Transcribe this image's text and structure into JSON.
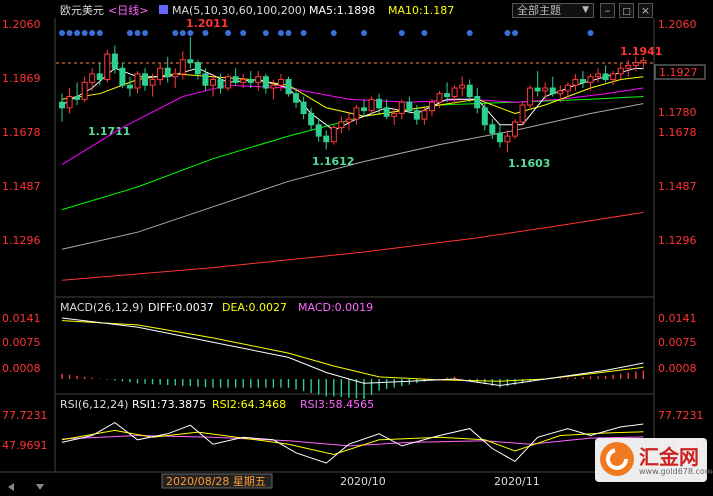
{
  "header": {
    "instrument": "欧元美元",
    "period": "<日线>",
    "ma_label": "MA(5,10,30,60,100,200)",
    "ma5_label": "MA5:1.1898",
    "ma10_label": "MA10:1.187",
    "theme_label": "全部主题",
    "colors": {
      "ma5": "#ffffff",
      "ma10": "#ffff00",
      "ma30": "#ff00ff",
      "ma60": "#00ff00",
      "ma100": "#aaaaaa",
      "ma200": "#ff3333"
    }
  },
  "price_axis": {
    "left": [
      "1.2060",
      "1.1869",
      "1.1678",
      "1.1487",
      "1.1296"
    ],
    "right": [
      "1.2060",
      "1.1927",
      "1.1780",
      "1.1678",
      "1.1487",
      "1.1296"
    ],
    "current": "1.1927"
  },
  "annotations": {
    "high": "1.2011",
    "recent_high": "1.1941",
    "low1": "1.1711",
    "low2": "1.1612",
    "low3": "1.1603"
  },
  "macd": {
    "title": "MACD(26,12,9)",
    "diff_label": "DIFF:0.0037",
    "dea_label": "DEA:0.0027",
    "macd_label": "MACD:0.0019",
    "axis": [
      "0.0141",
      "0.0075",
      "0.0008"
    ]
  },
  "rsi": {
    "title": "RSI(6,12,24)",
    "rsi1_label": "RSI1:73.3875",
    "rsi2_label": "RSI2:64.3468",
    "rsi3_label": "RSI3:58.4565",
    "axis": [
      "77.7231",
      "47.9691"
    ]
  },
  "x_axis": {
    "cursor_label": "2020/08/28 星期五",
    "ticks": [
      "2020/10",
      "2020/11"
    ]
  },
  "logo": {
    "name": "汇金网",
    "site": "www.gold678.com"
  },
  "chart_data": {
    "type": "candlestick",
    "title": "欧元美元 <日线>",
    "ylim": [
      1.12,
      1.206
    ],
    "candles": [
      {
        "o": 1.178,
        "h": 1.181,
        "l": 1.1711,
        "c": 1.176
      },
      {
        "o": 1.176,
        "h": 1.183,
        "l": 1.174,
        "c": 1.18
      },
      {
        "o": 1.18,
        "h": 1.185,
        "l": 1.177,
        "c": 1.179
      },
      {
        "o": 1.179,
        "h": 1.187,
        "l": 1.178,
        "c": 1.185
      },
      {
        "o": 1.185,
        "h": 1.19,
        "l": 1.182,
        "c": 1.188
      },
      {
        "o": 1.188,
        "h": 1.192,
        "l": 1.184,
        "c": 1.186
      },
      {
        "o": 1.186,
        "h": 1.1965,
        "l": 1.185,
        "c": 1.195
      },
      {
        "o": 1.195,
        "h": 1.198,
        "l": 1.188,
        "c": 1.19
      },
      {
        "o": 1.19,
        "h": 1.192,
        "l": 1.183,
        "c": 1.184
      },
      {
        "o": 1.184,
        "h": 1.187,
        "l": 1.18,
        "c": 1.183
      },
      {
        "o": 1.183,
        "h": 1.189,
        "l": 1.181,
        "c": 1.188
      },
      {
        "o": 1.188,
        "h": 1.19,
        "l": 1.182,
        "c": 1.184
      },
      {
        "o": 1.184,
        "h": 1.188,
        "l": 1.18,
        "c": 1.186
      },
      {
        "o": 1.186,
        "h": 1.192,
        "l": 1.184,
        "c": 1.19
      },
      {
        "o": 1.19,
        "h": 1.194,
        "l": 1.185,
        "c": 1.187
      },
      {
        "o": 1.187,
        "h": 1.19,
        "l": 1.183,
        "c": 1.188
      },
      {
        "o": 1.188,
        "h": 1.196,
        "l": 1.186,
        "c": 1.193
      },
      {
        "o": 1.193,
        "h": 1.2011,
        "l": 1.19,
        "c": 1.192
      },
      {
        "o": 1.192,
        "h": 1.193,
        "l": 1.186,
        "c": 1.188
      },
      {
        "o": 1.188,
        "h": 1.19,
        "l": 1.182,
        "c": 1.184
      },
      {
        "o": 1.184,
        "h": 1.188,
        "l": 1.18,
        "c": 1.186
      },
      {
        "o": 1.186,
        "h": 1.188,
        "l": 1.181,
        "c": 1.183
      },
      {
        "o": 1.183,
        "h": 1.188,
        "l": 1.182,
        "c": 1.187
      },
      {
        "o": 1.187,
        "h": 1.19,
        "l": 1.184,
        "c": 1.185
      },
      {
        "o": 1.185,
        "h": 1.188,
        "l": 1.183,
        "c": 1.186
      },
      {
        "o": 1.186,
        "h": 1.189,
        "l": 1.183,
        "c": 1.185
      },
      {
        "o": 1.185,
        "h": 1.189,
        "l": 1.182,
        "c": 1.187
      },
      {
        "o": 1.187,
        "h": 1.188,
        "l": 1.181,
        "c": 1.183
      },
      {
        "o": 1.183,
        "h": 1.186,
        "l": 1.179,
        "c": 1.184
      },
      {
        "o": 1.184,
        "h": 1.188,
        "l": 1.182,
        "c": 1.186
      },
      {
        "o": 1.186,
        "h": 1.187,
        "l": 1.18,
        "c": 1.181
      },
      {
        "o": 1.181,
        "h": 1.183,
        "l": 1.176,
        "c": 1.178
      },
      {
        "o": 1.178,
        "h": 1.18,
        "l": 1.172,
        "c": 1.174
      },
      {
        "o": 1.174,
        "h": 1.176,
        "l": 1.168,
        "c": 1.17
      },
      {
        "o": 1.17,
        "h": 1.172,
        "l": 1.164,
        "c": 1.166
      },
      {
        "o": 1.166,
        "h": 1.168,
        "l": 1.1612,
        "c": 1.164
      },
      {
        "o": 1.164,
        "h": 1.17,
        "l": 1.163,
        "c": 1.169
      },
      {
        "o": 1.169,
        "h": 1.173,
        "l": 1.167,
        "c": 1.171
      },
      {
        "o": 1.171,
        "h": 1.174,
        "l": 1.168,
        "c": 1.172
      },
      {
        "o": 1.172,
        "h": 1.177,
        "l": 1.17,
        "c": 1.176
      },
      {
        "o": 1.176,
        "h": 1.179,
        "l": 1.173,
        "c": 1.175
      },
      {
        "o": 1.175,
        "h": 1.18,
        "l": 1.174,
        "c": 1.179
      },
      {
        "o": 1.179,
        "h": 1.181,
        "l": 1.174,
        "c": 1.176
      },
      {
        "o": 1.176,
        "h": 1.179,
        "l": 1.172,
        "c": 1.173
      },
      {
        "o": 1.173,
        "h": 1.176,
        "l": 1.17,
        "c": 1.174
      },
      {
        "o": 1.174,
        "h": 1.179,
        "l": 1.172,
        "c": 1.178
      },
      {
        "o": 1.178,
        "h": 1.18,
        "l": 1.174,
        "c": 1.175
      },
      {
        "o": 1.175,
        "h": 1.177,
        "l": 1.17,
        "c": 1.172
      },
      {
        "o": 1.172,
        "h": 1.176,
        "l": 1.17,
        "c": 1.175
      },
      {
        "o": 1.175,
        "h": 1.179,
        "l": 1.173,
        "c": 1.178
      },
      {
        "o": 1.178,
        "h": 1.182,
        "l": 1.176,
        "c": 1.181
      },
      {
        "o": 1.181,
        "h": 1.185,
        "l": 1.178,
        "c": 1.18
      },
      {
        "o": 1.18,
        "h": 1.184,
        "l": 1.177,
        "c": 1.183
      },
      {
        "o": 1.183,
        "h": 1.187,
        "l": 1.18,
        "c": 1.184
      },
      {
        "o": 1.184,
        "h": 1.186,
        "l": 1.178,
        "c": 1.18
      },
      {
        "o": 1.18,
        "h": 1.183,
        "l": 1.174,
        "c": 1.176
      },
      {
        "o": 1.176,
        "h": 1.178,
        "l": 1.168,
        "c": 1.17
      },
      {
        "o": 1.17,
        "h": 1.172,
        "l": 1.165,
        "c": 1.167
      },
      {
        "o": 1.167,
        "h": 1.17,
        "l": 1.162,
        "c": 1.164
      },
      {
        "o": 1.164,
        "h": 1.168,
        "l": 1.1603,
        "c": 1.166
      },
      {
        "o": 1.166,
        "h": 1.172,
        "l": 1.165,
        "c": 1.171
      },
      {
        "o": 1.171,
        "h": 1.178,
        "l": 1.17,
        "c": 1.177
      },
      {
        "o": 1.177,
        "h": 1.184,
        "l": 1.176,
        "c": 1.183
      },
      {
        "o": 1.183,
        "h": 1.189,
        "l": 1.18,
        "c": 1.182
      },
      {
        "o": 1.182,
        "h": 1.185,
        "l": 1.179,
        "c": 1.183
      },
      {
        "o": 1.183,
        "h": 1.187,
        "l": 1.18,
        "c": 1.181
      },
      {
        "o": 1.181,
        "h": 1.184,
        "l": 1.178,
        "c": 1.182
      },
      {
        "o": 1.182,
        "h": 1.185,
        "l": 1.18,
        "c": 1.184
      },
      {
        "o": 1.184,
        "h": 1.188,
        "l": 1.182,
        "c": 1.186
      },
      {
        "o": 1.186,
        "h": 1.189,
        "l": 1.183,
        "c": 1.185
      },
      {
        "o": 1.185,
        "h": 1.188,
        "l": 1.182,
        "c": 1.187
      },
      {
        "o": 1.187,
        "h": 1.19,
        "l": 1.185,
        "c": 1.188
      },
      {
        "o": 1.188,
        "h": 1.191,
        "l": 1.185,
        "c": 1.186
      },
      {
        "o": 1.186,
        "h": 1.189,
        "l": 1.184,
        "c": 1.188
      },
      {
        "o": 1.188,
        "h": 1.192,
        "l": 1.186,
        "c": 1.19
      },
      {
        "o": 1.19,
        "h": 1.193,
        "l": 1.187,
        "c": 1.191
      },
      {
        "o": 1.191,
        "h": 1.1941,
        "l": 1.189,
        "c": 1.192
      },
      {
        "o": 1.192,
        "h": 1.194,
        "l": 1.19,
        "c": 1.1927
      }
    ],
    "ma": {
      "ma5": [
        [
          0,
          1.177
        ],
        [
          4,
          1.183
        ],
        [
          7,
          1.19
        ],
        [
          10,
          1.187
        ],
        [
          14,
          1.187
        ],
        [
          18,
          1.19
        ],
        [
          22,
          1.185
        ],
        [
          26,
          1.186
        ],
        [
          30,
          1.183
        ],
        [
          33,
          1.174
        ],
        [
          36,
          1.168
        ],
        [
          39,
          1.172
        ],
        [
          43,
          1.176
        ],
        [
          47,
          1.174
        ],
        [
          51,
          1.179
        ],
        [
          55,
          1.179
        ],
        [
          58,
          1.17
        ],
        [
          61,
          1.17
        ],
        [
          64,
          1.18
        ],
        [
          68,
          1.184
        ],
        [
          72,
          1.187
        ],
        [
          76,
          1.19
        ],
        [
          77,
          1.1898
        ]
      ],
      "ma10": [
        [
          0,
          1.179
        ],
        [
          5,
          1.181
        ],
        [
          10,
          1.186
        ],
        [
          15,
          1.188
        ],
        [
          20,
          1.187
        ],
        [
          25,
          1.186
        ],
        [
          30,
          1.184
        ],
        [
          35,
          1.176
        ],
        [
          40,
          1.173
        ],
        [
          45,
          1.175
        ],
        [
          50,
          1.177
        ],
        [
          55,
          1.179
        ],
        [
          60,
          1.174
        ],
        [
          64,
          1.177
        ],
        [
          70,
          1.183
        ],
        [
          74,
          1.186
        ],
        [
          77,
          1.187
        ]
      ],
      "ma30": [
        [
          0,
          1.156
        ],
        [
          8,
          1.169
        ],
        [
          16,
          1.18
        ],
        [
          22,
          1.184
        ],
        [
          30,
          1.183
        ],
        [
          38,
          1.179
        ],
        [
          46,
          1.178
        ],
        [
          54,
          1.179
        ],
        [
          60,
          1.178
        ],
        [
          66,
          1.179
        ],
        [
          72,
          1.181
        ],
        [
          77,
          1.183
        ]
      ],
      "ma60": [
        [
          0,
          1.14
        ],
        [
          10,
          1.148
        ],
        [
          20,
          1.158
        ],
        [
          30,
          1.166
        ],
        [
          40,
          1.173
        ],
        [
          50,
          1.177
        ],
        [
          60,
          1.178
        ],
        [
          70,
          1.179
        ],
        [
          77,
          1.18
        ]
      ],
      "ma100": [
        [
          0,
          1.126
        ],
        [
          10,
          1.132
        ],
        [
          20,
          1.141
        ],
        [
          30,
          1.15
        ],
        [
          40,
          1.157
        ],
        [
          50,
          1.163
        ],
        [
          60,
          1.168
        ],
        [
          70,
          1.174
        ],
        [
          77,
          1.1775
        ]
      ],
      "ma200": [
        [
          0,
          1.115
        ],
        [
          20,
          1.1195
        ],
        [
          40,
          1.125
        ],
        [
          55,
          1.13
        ],
        [
          65,
          1.134
        ],
        [
          77,
          1.139
        ]
      ]
    },
    "macd_series": {
      "diff": [
        [
          0,
          0.0141
        ],
        [
          10,
          0.012
        ],
        [
          20,
          0.0085
        ],
        [
          30,
          0.005
        ],
        [
          35,
          0.0015
        ],
        [
          40,
          -0.001
        ],
        [
          46,
          -0.0005
        ],
        [
          52,
          0.0
        ],
        [
          58,
          -0.0015
        ],
        [
          62,
          -0.0005
        ],
        [
          66,
          0.0005
        ],
        [
          72,
          0.002
        ],
        [
          77,
          0.0037
        ]
      ],
      "dea": [
        [
          0,
          0.0135
        ],
        [
          10,
          0.0125
        ],
        [
          20,
          0.0095
        ],
        [
          30,
          0.006
        ],
        [
          36,
          0.003
        ],
        [
          42,
          0.0005
        ],
        [
          50,
          -0.0002
        ],
        [
          58,
          -0.0005
        ],
        [
          64,
          0.0
        ],
        [
          70,
          0.0012
        ],
        [
          77,
          0.0027
        ]
      ]
    },
    "rsi_series": {
      "rsi1": [
        [
          0,
          52
        ],
        [
          4,
          60
        ],
        [
          7,
          75
        ],
        [
          10,
          55
        ],
        [
          14,
          62
        ],
        [
          17,
          72
        ],
        [
          20,
          50
        ],
        [
          24,
          58
        ],
        [
          28,
          55
        ],
        [
          31,
          40
        ],
        [
          35,
          28
        ],
        [
          38,
          50
        ],
        [
          42,
          62
        ],
        [
          45,
          48
        ],
        [
          50,
          60
        ],
        [
          54,
          68
        ],
        [
          57,
          45
        ],
        [
          60,
          30
        ],
        [
          63,
          58
        ],
        [
          67,
          68
        ],
        [
          70,
          60
        ],
        [
          74,
          70
        ],
        [
          77,
          73.39
        ]
      ],
      "rsi2": [
        [
          0,
          55
        ],
        [
          7,
          66
        ],
        [
          12,
          58
        ],
        [
          18,
          64
        ],
        [
          24,
          57
        ],
        [
          30,
          50
        ],
        [
          36,
          38
        ],
        [
          42,
          55
        ],
        [
          50,
          58
        ],
        [
          56,
          55
        ],
        [
          60,
          42
        ],
        [
          66,
          60
        ],
        [
          72,
          63
        ],
        [
          77,
          64.35
        ]
      ],
      "rsi3": [
        [
          0,
          56
        ],
        [
          10,
          60
        ],
        [
          20,
          58
        ],
        [
          30,
          54
        ],
        [
          38,
          48
        ],
        [
          46,
          52
        ],
        [
          56,
          54
        ],
        [
          62,
          50
        ],
        [
          70,
          57
        ],
        [
          77,
          58.46
        ]
      ]
    }
  }
}
